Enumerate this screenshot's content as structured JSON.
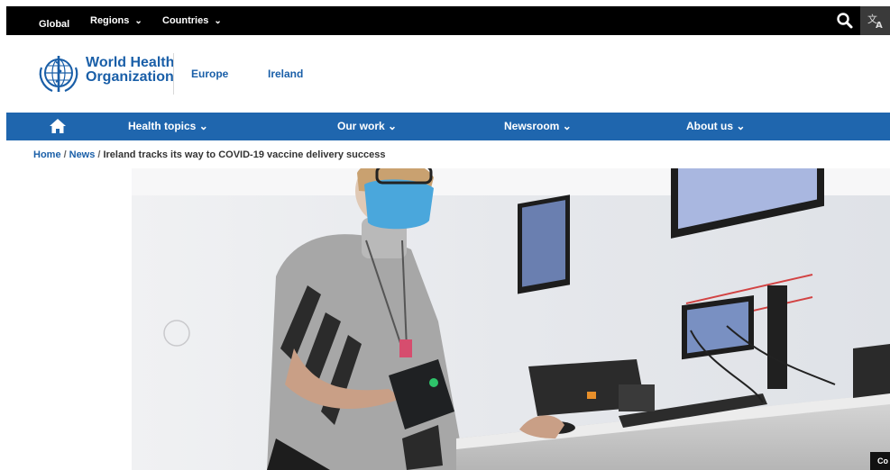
{
  "topbar": {
    "global": "Global",
    "regions": "Regions",
    "countries": "Countries",
    "chevron": "⌄",
    "search_icon": "search-icon",
    "translate_icon": "translate-icon"
  },
  "brand": {
    "logo_line1": "World Health",
    "logo_line2": "Organization",
    "region": "Europe",
    "country": "Ireland"
  },
  "mainnav": {
    "items": [
      "Health topics",
      "Our work",
      "Newsroom",
      "About us"
    ],
    "chevron": "⌄",
    "home_icon": "home-icon"
  },
  "breadcrumb": {
    "home": "Home",
    "news": "News",
    "separator": "/",
    "current": "Ireland tracks its way to COVID-19 vaccine delivery success"
  },
  "hero": {
    "credit": "Co"
  },
  "colors": {
    "topbar": "#000000",
    "nav_blue": "#1f66ae",
    "link_blue": "#1a5fa8"
  }
}
